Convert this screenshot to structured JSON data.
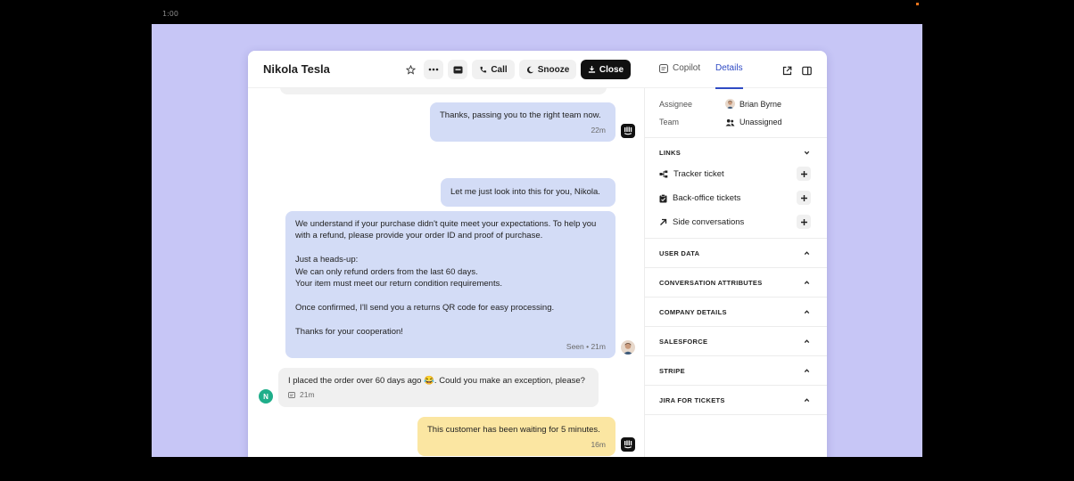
{
  "video": {
    "time_label": "1:00"
  },
  "header": {
    "contact_name": "Nikola Tesla",
    "call_label": "Call",
    "snooze_label": "Snooze",
    "close_label": "Close"
  },
  "messages": [
    {
      "text": "Thanks, passing you to the right team now.",
      "time": "22m",
      "author": "bot"
    },
    {
      "text": "Let me just look into this for you, Nikola.",
      "author": "bot"
    },
    {
      "author": "agent",
      "paragraphs": [
        "We understand if your purchase didn't quite meet your expectations. To help you with a refund, please provide your order ID and proof of purchase.",
        "Just a heads-up:",
        "We can only refund orders from the last 60 days.",
        "Your item must meet our return condition requirements.",
        "Once confirmed, I'll send you a returns QR code for easy processing.",
        "Thanks for your cooperation!"
      ],
      "status": "Seen • 21m"
    },
    {
      "author": "customer",
      "text": "I placed the order over 60 days ago 😂. Could you make an exception, please?",
      "time": "21m",
      "avatar_letter": "N"
    },
    {
      "author": "note",
      "text": "This customer has been waiting for 5 minutes.",
      "time": "16m"
    }
  ],
  "sidebar": {
    "tabs": {
      "copilot": "Copilot",
      "details": "Details"
    },
    "assignee_label": "Assignee",
    "assignee_value": "Brian Byrne",
    "team_label": "Team",
    "team_value": "Unassigned",
    "links_header": "LINKS",
    "links": [
      "Tracker ticket",
      "Back-office tickets",
      "Side conversations"
    ],
    "sections": [
      "USER DATA",
      "CONVERSATION ATTRIBUTES",
      "COMPANY DETAILS",
      "SALESFORCE",
      "STRIPE",
      "JIRA FOR TICKETS"
    ]
  },
  "colors": {
    "stage_bg": "#c7c6f6",
    "agent_bubble": "#d3dcf6",
    "customer_bubble": "#f0f0f0",
    "note_bubble": "#fbe6a2",
    "accent": "#2f4ac4"
  },
  "icons": [
    "star-icon",
    "more-icon",
    "ticket-icon",
    "phone-icon",
    "snooze-icon",
    "close-inbox-icon",
    "copilot-icon",
    "external-link-icon",
    "panel-toggle-icon",
    "team-icon",
    "tracker-icon",
    "clipboard-icon",
    "arrow-up-right-icon",
    "plus-icon",
    "chevron-icon",
    "note-icon",
    "bot-avatar-icon"
  ]
}
